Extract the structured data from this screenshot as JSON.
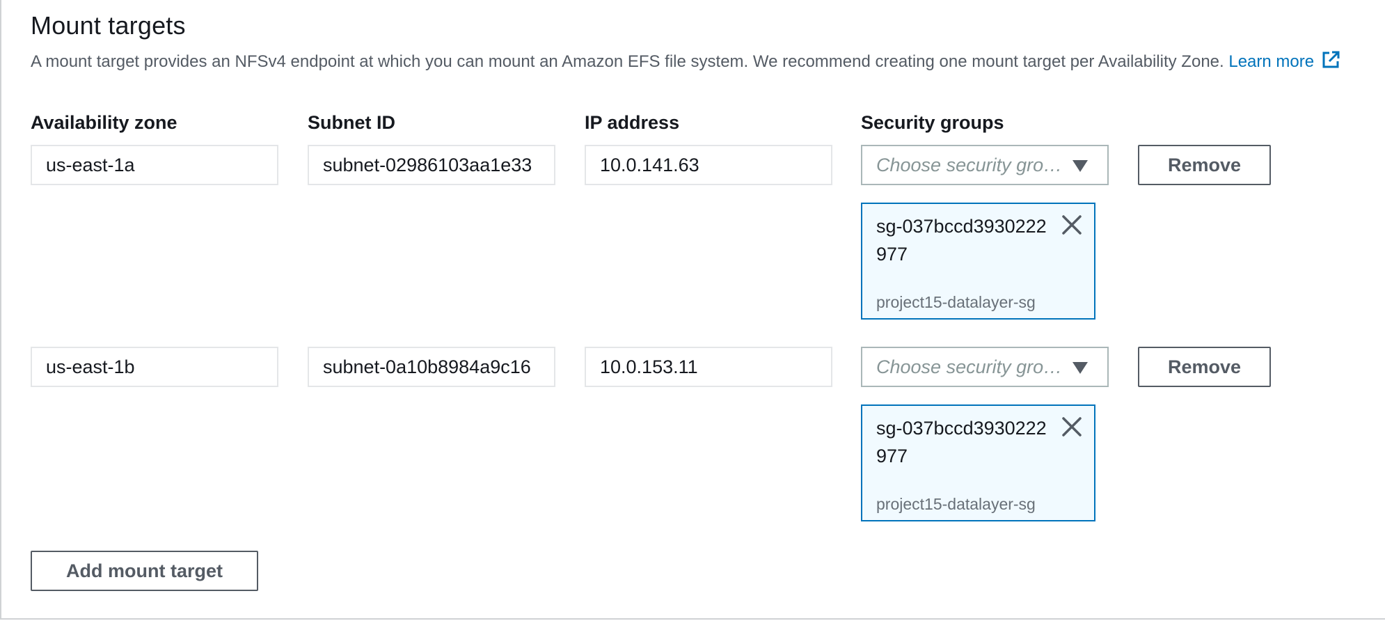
{
  "section": {
    "title": "Mount targets",
    "description": "A mount target provides an NFSv4 endpoint at which you can mount an Amazon EFS file system. We recommend creating one mount target per Availability Zone.",
    "learn_more": "Learn more"
  },
  "columns": {
    "availability_zone": "Availability zone",
    "subnet_id": "Subnet ID",
    "ip_address": "IP address",
    "security_groups": "Security groups"
  },
  "mount_targets": [
    {
      "availability_zone": "us-east-1a",
      "subnet_id": "subnet-02986103aa1e33",
      "ip_address": "10.0.141.63",
      "security_group_placeholder": "Choose security groups",
      "security_group_token": {
        "id": "sg-037bccd3930222977",
        "name": "project15-datalayer-sg"
      },
      "remove_label": "Remove"
    },
    {
      "availability_zone": "us-east-1b",
      "subnet_id": "subnet-0a10b8984a9c16",
      "ip_address": "10.0.153.11",
      "security_group_placeholder": "Choose security groups",
      "security_group_token": {
        "id": "sg-037bccd3930222977",
        "name": "project15-datalayer-sg"
      },
      "remove_label": "Remove"
    }
  ],
  "add_mount_target_label": "Add mount target",
  "colors": {
    "link": "#0073bb",
    "token_border": "#0073bb",
    "token_background": "#f1faff",
    "text": "#16191f",
    "secondary_text": "#545b64"
  },
  "icons": {
    "external_link": "external-link-icon",
    "dropdown": "caret-down-icon",
    "dismiss": "close-icon"
  }
}
